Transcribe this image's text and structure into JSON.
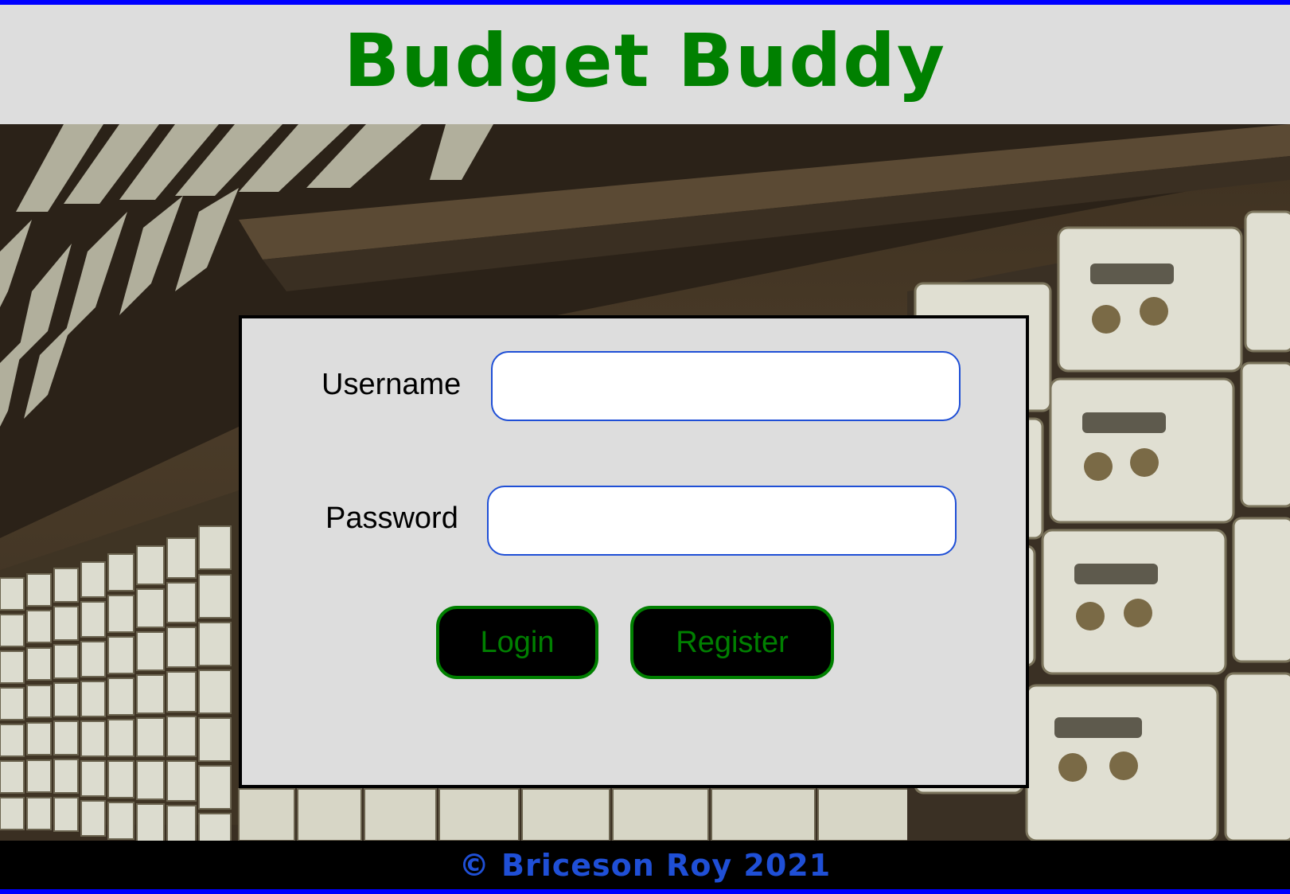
{
  "colors": {
    "accent_border": "#0000ff",
    "header_bg": "#dddddd",
    "title": "#008000",
    "panel_bg": "#dddddd",
    "panel_border": "#000000",
    "input_border": "#1f4fd6",
    "button_bg": "#000000",
    "button_text": "#008000",
    "footer_bg": "#000000",
    "footer_text": "#1f4fd6"
  },
  "header": {
    "title": "Budget Buddy"
  },
  "hero": {
    "image": "safe-deposit-boxes-photo"
  },
  "login_form": {
    "username_label": "Username",
    "username_value": "",
    "password_label": "Password",
    "password_value": "",
    "login_button": "Login",
    "register_button": "Register"
  },
  "footer": {
    "copyright": "© Briceson Roy 2021"
  }
}
